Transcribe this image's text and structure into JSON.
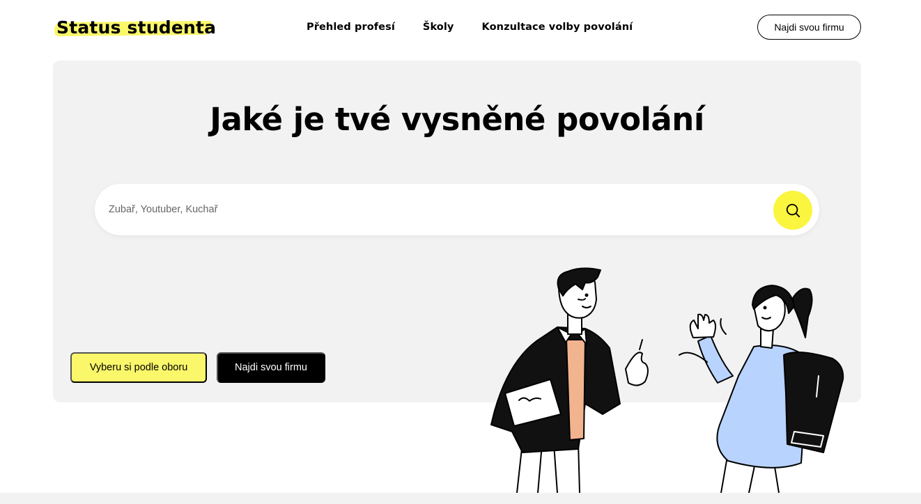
{
  "brand": {
    "name": "Status studenta",
    "highlight_color": "#faf76a"
  },
  "nav": {
    "items": [
      {
        "label": "Přehled profesí"
      },
      {
        "label": "Školy"
      },
      {
        "label": "Konzultace volby povolání"
      }
    ]
  },
  "header": {
    "cta_label": "Najdi svou firmu"
  },
  "hero": {
    "title": "Jaké je tvé vysněné povolání",
    "search": {
      "placeholder": "Zubař, Youtuber, Kuchař",
      "value": "",
      "button_icon": "search-icon",
      "button_color": "#faf53e"
    },
    "buttons": {
      "by_field_label": "Vyberu si podle oboru",
      "find_company_label": "Najdi svou firmu"
    },
    "background_color": "#f2f2f2"
  },
  "illustration": {
    "subject": "students-illustration"
  }
}
